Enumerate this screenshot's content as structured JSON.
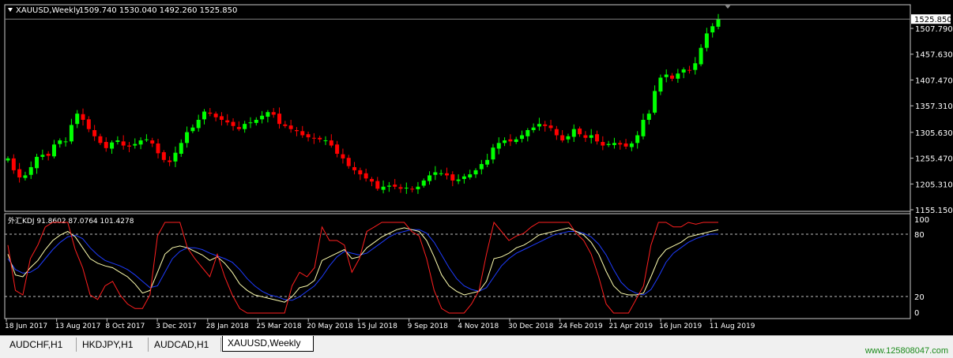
{
  "main_chart": {
    "symbol_label": "XAUUSD,Weekly",
    "ohlc_label": "1509.740 1530.040 1492.260 1525.850",
    "current_price": "1525.850",
    "price_labels": [
      "1507.790",
      "1457.630",
      "1407.470",
      "1357.310",
      "1305.630",
      "1255.470",
      "1205.310",
      "1155.150"
    ],
    "price_values": [
      1507.79,
      1457.63,
      1407.47,
      1357.31,
      1305.63,
      1255.47,
      1205.31,
      1155.15
    ]
  },
  "indicator": {
    "label": "外汇KDJ 91.8602 87.0764 101.4278",
    "levels": [
      "100",
      "80",
      "20",
      "0"
    ]
  },
  "time_axis": [
    "18 Jun 2017",
    "13 Aug 2017",
    "8 Oct 2017",
    "3 Dec 2017",
    "28 Jan 2018",
    "25 Mar 2018",
    "20 May 2018",
    "15 Jul 2018",
    "9 Sep 2018",
    "4 Nov 2018",
    "30 Dec 2018",
    "24 Feb 2019",
    "21 Apr 2019",
    "16 Jun 2019",
    "11 Aug 2019"
  ],
  "tabs": [
    "AUDCHF,H1",
    "HKDJPY,H1",
    "AUDCAD,H1",
    "XAUUSD,Weekly"
  ],
  "active_tab": 3,
  "watermark": "www.125808047.com",
  "colors": {
    "bull": "#00ff00",
    "bear": "#ff0000",
    "k_line": "#ffffb0",
    "d_line": "#1e3cff",
    "j_line": "#ff1f1f",
    "grid": "#ffffff"
  },
  "chart_data": {
    "type": "candlestick",
    "title": "XAUUSD,Weekly",
    "ylim": [
      1155.15,
      1525.85
    ],
    "closes": [
      1255,
      1232,
      1218,
      1222,
      1238,
      1258,
      1262,
      1260,
      1282,
      1290,
      1288,
      1320,
      1342,
      1330,
      1312,
      1298,
      1285,
      1275,
      1286,
      1290,
      1280,
      1278,
      1283,
      1290,
      1292,
      1284,
      1265,
      1252,
      1248,
      1266,
      1285,
      1306,
      1315,
      1330,
      1346,
      1342,
      1335,
      1330,
      1325,
      1318,
      1312,
      1322,
      1325,
      1330,
      1338,
      1345,
      1340,
      1322,
      1318,
      1312,
      1308,
      1300,
      1296,
      1294,
      1292,
      1290,
      1280,
      1264,
      1255,
      1240,
      1232,
      1224,
      1216,
      1210,
      1196,
      1200,
      1202,
      1200,
      1196,
      1198,
      1195,
      1200,
      1212,
      1222,
      1228,
      1226,
      1222,
      1212,
      1214,
      1220,
      1224,
      1232,
      1244,
      1252,
      1276,
      1285,
      1290,
      1288,
      1292,
      1300,
      1310,
      1315,
      1322,
      1318,
      1314,
      1300,
      1290,
      1298,
      1312,
      1302,
      1295,
      1300,
      1288,
      1280,
      1283,
      1285,
      1282,
      1278,
      1284,
      1300,
      1330,
      1342,
      1386,
      1412,
      1418,
      1410,
      1420,
      1428,
      1426,
      1440,
      1470,
      1498,
      1512,
      1525.85
    ],
    "k": [
      65,
      42,
      40,
      50,
      58,
      70,
      80,
      86,
      90,
      84,
      72,
      60,
      55,
      52,
      50,
      45,
      40,
      32,
      22,
      25,
      45,
      65,
      72,
      74,
      72,
      68,
      64,
      58,
      62,
      55,
      45,
      32,
      25,
      20,
      18,
      16,
      14,
      12,
      18,
      28,
      30,
      36,
      58,
      62,
      66,
      70,
      60,
      62,
      72,
      78,
      84,
      88,
      92,
      94,
      92,
      90,
      80,
      62,
      42,
      30,
      24,
      20,
      22,
      24,
      35,
      60,
      62,
      66,
      72,
      75,
      80,
      86,
      88,
      90,
      92,
      94,
      90,
      86,
      78,
      65,
      46,
      30,
      22,
      20,
      20,
      22,
      40,
      60,
      70,
      74,
      78,
      84,
      86,
      88,
      90,
      91.86
    ],
    "d": [
      60,
      48,
      44,
      45,
      50,
      60,
      70,
      78,
      84,
      86,
      82,
      72,
      64,
      58,
      55,
      52,
      48,
      42,
      35,
      28,
      30,
      45,
      60,
      68,
      72,
      72,
      70,
      66,
      63,
      60,
      56,
      48,
      38,
      30,
      24,
      20,
      18,
      15,
      14,
      18,
      24,
      30,
      40,
      52,
      62,
      68,
      66,
      64,
      66,
      72,
      78,
      84,
      88,
      90,
      92,
      92,
      88,
      78,
      64,
      50,
      38,
      30,
      26,
      24,
      28,
      40,
      52,
      60,
      66,
      70,
      74,
      78,
      82,
      86,
      88,
      90,
      90,
      88,
      84,
      76,
      64,
      48,
      34,
      26,
      22,
      20,
      26,
      40,
      56,
      66,
      72,
      78,
      82,
      85,
      87,
      87.08
    ],
    "j": [
      75,
      25,
      20,
      60,
      75,
      95,
      100,
      100,
      100,
      70,
      50,
      20,
      15,
      30,
      35,
      20,
      10,
      5,
      5,
      20,
      85,
      100,
      100,
      100,
      72,
      60,
      50,
      40,
      65,
      40,
      20,
      5,
      0,
      0,
      0,
      0,
      0,
      0,
      30,
      45,
      40,
      50,
      95,
      80,
      80,
      75,
      45,
      60,
      90,
      95,
      100,
      100,
      100,
      100,
      90,
      85,
      60,
      25,
      5,
      0,
      0,
      0,
      10,
      25,
      65,
      100,
      90,
      80,
      85,
      88,
      95,
      100,
      100,
      100,
      100,
      100,
      88,
      80,
      65,
      40,
      10,
      0,
      0,
      0,
      15,
      30,
      75,
      100,
      100,
      95,
      95,
      100,
      98,
      100,
      100,
      100
    ]
  }
}
